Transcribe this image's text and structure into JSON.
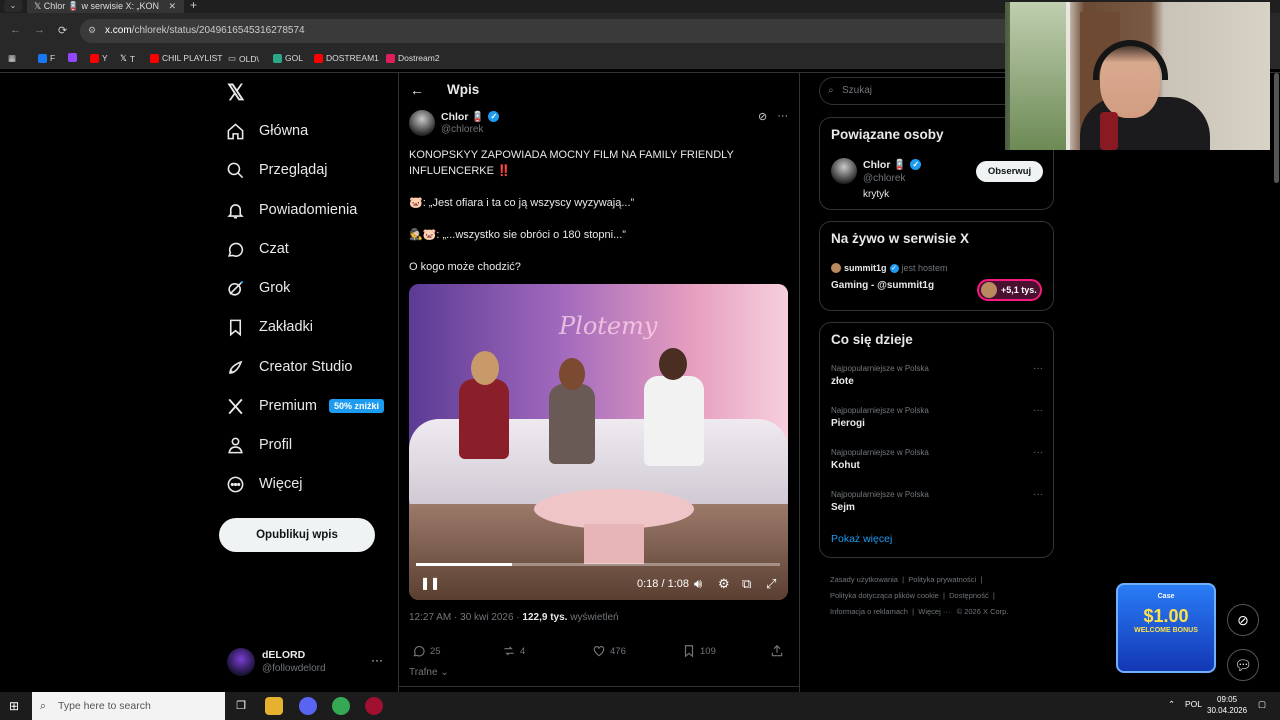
{
  "browser": {
    "tab_title": "Chlor 🪫 w serwisie X: „KON",
    "url_prefix": "x.com",
    "url_rest": "/chlorek/status/2049616545316278574",
    "bookmarks": [
      "F",
      "Y",
      "T",
      "CHIL PLAYLIST",
      "OLD\\",
      "GOL",
      "DOSTREAM1",
      "Dostream2"
    ]
  },
  "nav": {
    "logo": "𝕏",
    "items": [
      "Główna",
      "Przeglądaj",
      "Powiadomienia",
      "Czat",
      "Grok",
      "Zakładki",
      "Creator Studio",
      "Premium",
      "Profil",
      "Więcej"
    ],
    "premium_badge": "50% zniżki",
    "post_button": "Opublikuj wpis",
    "me_name": "dELORD",
    "me_handle": "@followdelord"
  },
  "post": {
    "header": "Wpis",
    "author_name": "Chlor 🪫",
    "author_handle": "@chlorek",
    "line1": "KONOPSKYY ZAPOWIADA MOCNY FILM NA FAMILY FRIENDLY INFLUENCERKE",
    "line1_emoji": "‼️",
    "line2": "🐷: „Jest ofiara i ta co ją wszyscy wyzywają...”",
    "line3": "🕵️🐷: „...wszystko sie obróci o 180 stopni...”",
    "line4": "O kogo może chodzić?",
    "video_neon": "Plotemy",
    "video_time": "0:18 / 1:08",
    "video_progress": 0.265,
    "timestamp": "12:27 AM · 30 kwi 2026 · ",
    "views": "122,9 tys.",
    "views_label": " wyświetleń",
    "replies": "25",
    "reposts": "4",
    "likes": "476",
    "bookmarks": "109",
    "sort_label": "Trafne"
  },
  "sidebar": {
    "search_placeholder": "Szukaj",
    "related_title": "Powiązane osoby",
    "related_name": "Chlor 🪫",
    "related_handle": "@chlorek",
    "related_bio": "krytyk",
    "follow_button": "Obserwuj",
    "live_title": "Na żywo w serwisie X",
    "live_host": "summit1g",
    "live_host_suffix": "jest hostem",
    "live_stream": "Gaming - @summit1g",
    "live_count": "+5,1 tys.",
    "trends_title": "Co się dzieje",
    "trends": [
      {
        "context": "Najpopularniejsze w Polska",
        "name": "złote"
      },
      {
        "context": "Najpopularniejsze w Polska",
        "name": "Pierogi"
      },
      {
        "context": "Najpopularniejsze w Polska",
        "name": "Kohut"
      },
      {
        "context": "Najpopularniejsze w Polska",
        "name": "Sejm"
      }
    ],
    "show_more": "Pokaż więcej",
    "footer_links": [
      "Zasady użytkowania",
      "Polityka prywatności",
      "Polityka dotycząca plików cookie",
      "Dostępność",
      "Informacja o reklamach",
      "Więcej ···",
      "© 2026 X Corp."
    ]
  },
  "promo": {
    "brand": "Case",
    "amount": "$1.00",
    "label": "WELCOME BONUS"
  },
  "taskbar": {
    "search_placeholder": "Type here to search",
    "lang": "POL",
    "time": "09:05",
    "date": "30.04.2026"
  }
}
